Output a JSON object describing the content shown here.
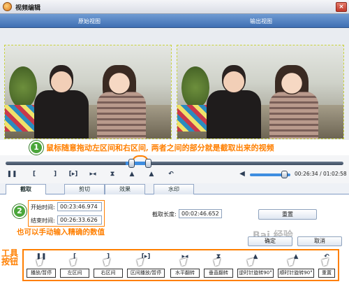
{
  "window": {
    "title": "视频编辑",
    "close_icon": "×"
  },
  "view_header": {
    "original": "原始视图",
    "output": "输出视图"
  },
  "annotations": {
    "step1_number": "1",
    "step1_text": "鼠标随意拖动左区间和右区间, 两者之间的部分就是截取出来的视频",
    "step2_number": "2",
    "step2_text": "也可以手动输入精确的数值",
    "legend_title": "工具按钮"
  },
  "controls": {
    "play": "❚❚",
    "mark_in": "[",
    "mark_out": "]",
    "play_range": "[▸]",
    "flip_h": "▸◂",
    "flip_v": "⧗",
    "rotate_ccw": "▲",
    "rotate_cw": "▲",
    "reset": "↶",
    "volume_icon": "◀",
    "volume_level": 0.85,
    "time": "00:26:34 / 01:02:58"
  },
  "tabs": [
    {
      "label": "截取",
      "active": true
    },
    {
      "label": "剪切",
      "active": false
    },
    {
      "label": "效果",
      "active": false
    },
    {
      "label": "水印",
      "active": false
    }
  ],
  "crop": {
    "start_label": "开始时间:",
    "start_value": "00:23:46.974",
    "end_label": "结束时间:",
    "end_value": "00:26:33.626",
    "length_label": "截取长度:",
    "length_value": "00:02:46.652",
    "reset_label": "重置"
  },
  "dialog": {
    "ok": "确定",
    "cancel": "取消"
  },
  "watermark": "Bai 经验",
  "tools": [
    {
      "icon": "❚❚",
      "label": "播放/暂停"
    },
    {
      "icon": "[",
      "label": "左区间"
    },
    {
      "icon": "]",
      "label": "右区间"
    },
    {
      "icon": "[▸]",
      "label": "区间播放/暂停"
    },
    {
      "icon": "▸◂",
      "label": "水平翻转"
    },
    {
      "icon": "⧗",
      "label": "垂直翻转"
    },
    {
      "icon": "▲",
      "label": "逆时针旋转90°"
    },
    {
      "icon": "▲",
      "label": "顺时针旋转90°"
    },
    {
      "icon": "↶",
      "label": "重置"
    }
  ],
  "colors": {
    "accent": "#ff7f00",
    "header": "#4f7fc0",
    "badge": "#4aa63a"
  }
}
